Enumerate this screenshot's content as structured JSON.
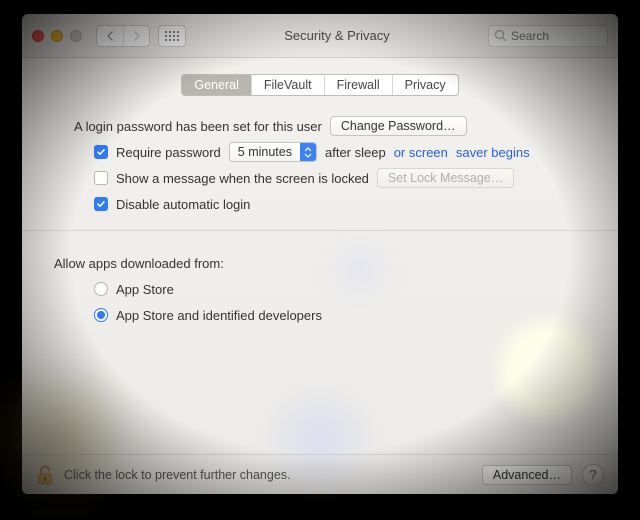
{
  "window": {
    "title": "Security & Privacy"
  },
  "toolbar": {
    "search_placeholder": "Search"
  },
  "tabs": [
    "General",
    "FileVault",
    "Firewall",
    "Privacy"
  ],
  "active_tab": "General",
  "login": {
    "heading": "A login password has been set for this user",
    "change_password_label": "Change Password…",
    "require_password": {
      "checked": true,
      "label_before": "Require password",
      "delay_value": "5 minutes",
      "label_after_1": "after sleep",
      "label_after_2": "or screen",
      "label_after_link": "saver begins"
    },
    "show_message": {
      "checked": false,
      "label": "Show a message when the screen is locked",
      "button_label": "Set Lock Message…"
    },
    "disable_auto_login": {
      "checked": true,
      "label": "Disable automatic login"
    }
  },
  "gatekeeper": {
    "heading": "Allow apps downloaded from:",
    "options": [
      "App Store",
      "App Store and identified developers"
    ],
    "selected_index": 1
  },
  "footer": {
    "lock_message": "Click the lock to prevent further changes.",
    "advanced_label": "Advanced…",
    "help_label": "?"
  }
}
